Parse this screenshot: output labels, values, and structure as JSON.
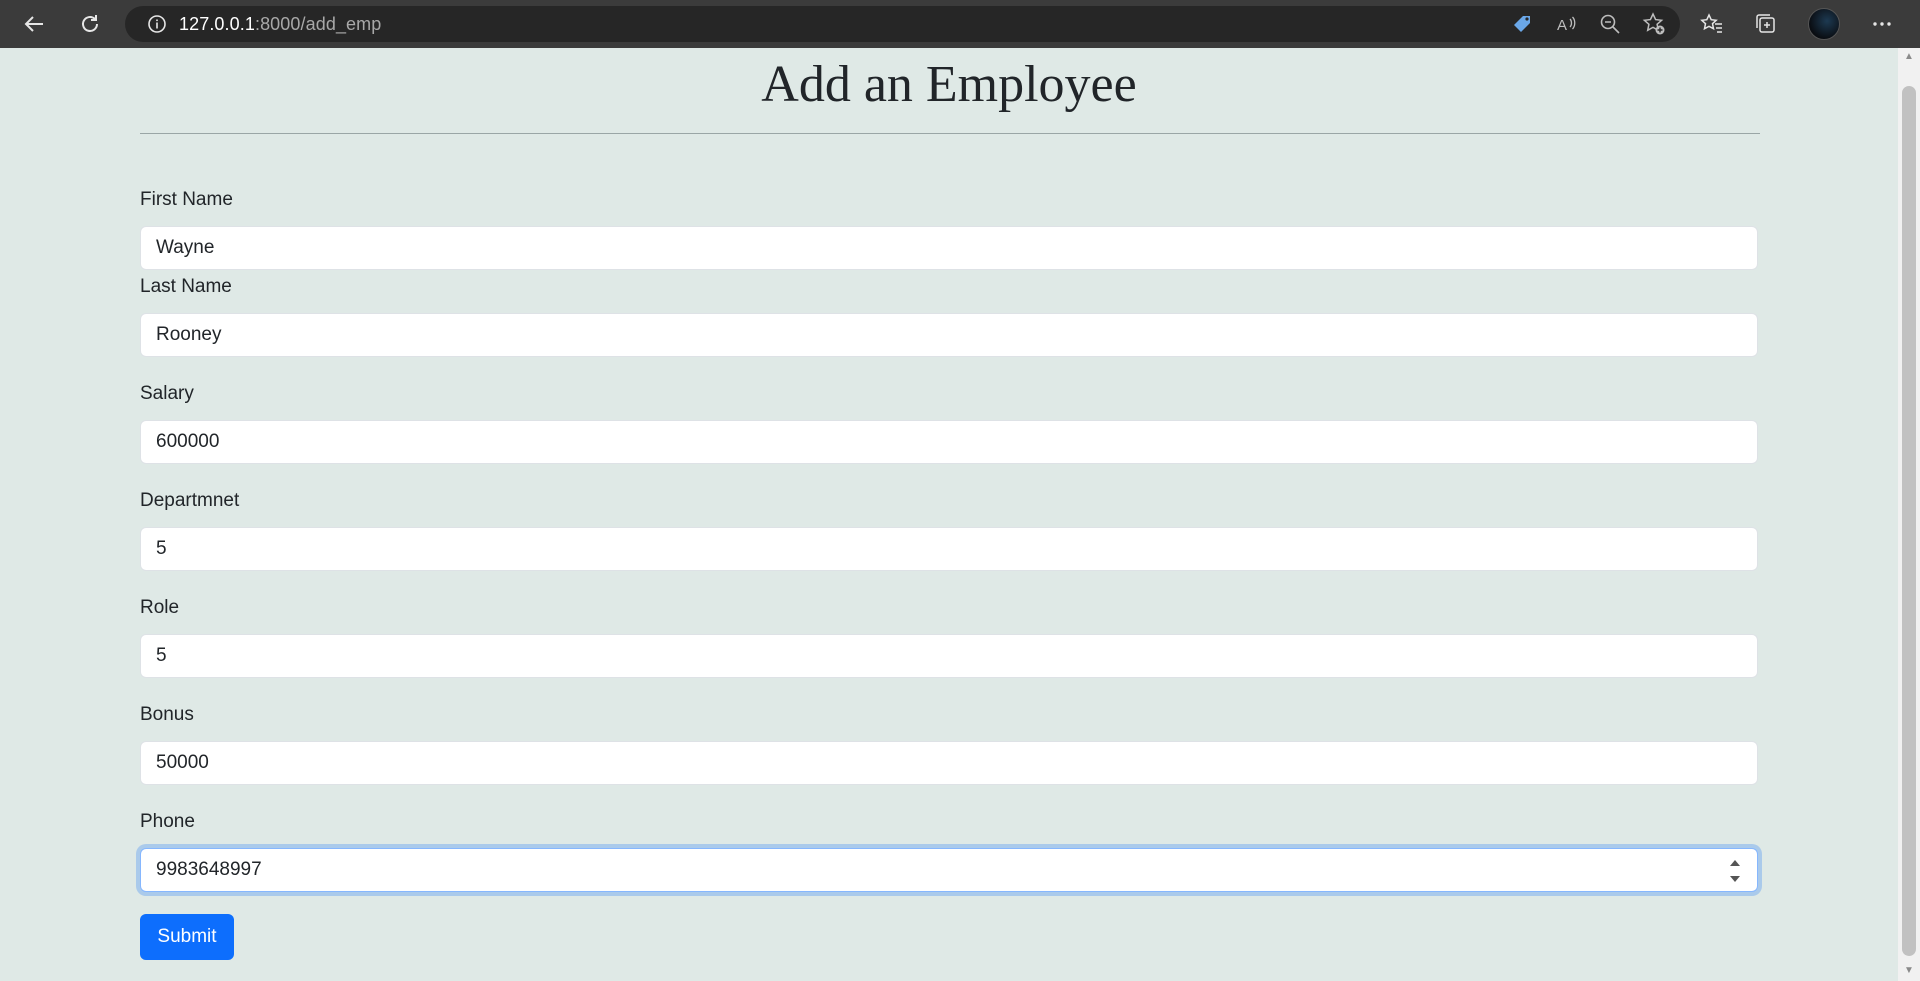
{
  "browser": {
    "url_host": "127.0.0.1",
    "url_path": ":8000/add_emp"
  },
  "page": {
    "title": "Add an Employee"
  },
  "form": {
    "fields": [
      {
        "label": "First Name",
        "value": "Wayne"
      },
      {
        "label": "Last Name",
        "value": "Rooney"
      },
      {
        "label": "Salary",
        "value": "600000"
      },
      {
        "label": "Departmnet",
        "value": "5"
      },
      {
        "label": "Role",
        "value": "5"
      },
      {
        "label": "Bonus",
        "value": "50000"
      },
      {
        "label": "Phone",
        "value": "9983648997"
      }
    ],
    "submit_label": "Submit"
  },
  "colors": {
    "page_bg": "#dfe9e6",
    "primary": "#0d6efd",
    "chrome_bg": "#3b3b3b"
  }
}
